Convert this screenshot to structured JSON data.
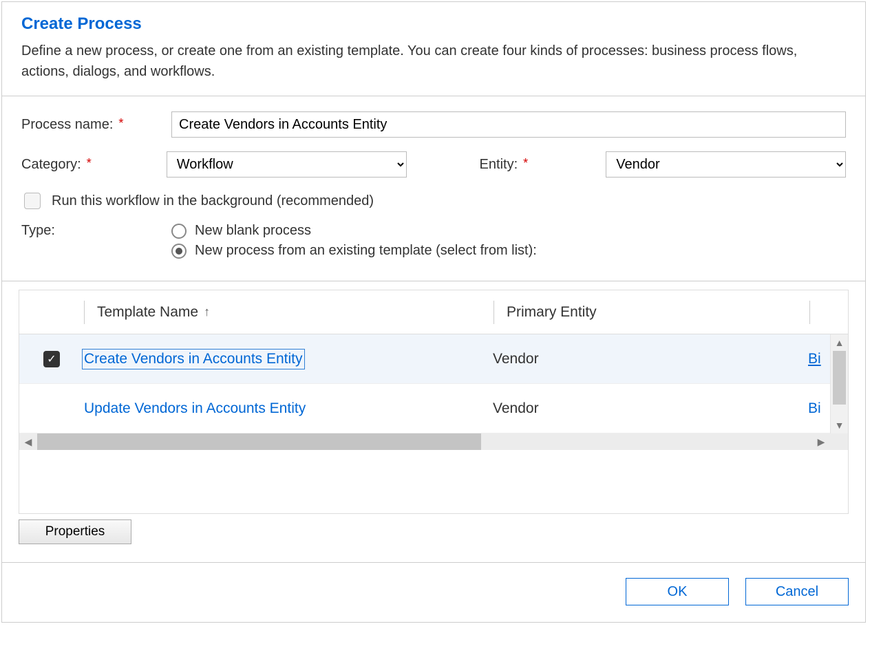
{
  "header": {
    "title": "Create Process",
    "description": "Define a new process, or create one from an existing template. You can create four kinds of processes: business process flows, actions, dialogs, and workflows."
  },
  "form": {
    "process_name_label": "Process name:",
    "process_name_value": "Create Vendors in Accounts Entity",
    "category_label": "Category:",
    "category_value": "Workflow",
    "entity_label": "Entity:",
    "entity_value": "Vendor",
    "background_label": "Run this workflow in the background (recommended)",
    "background_checked": false,
    "type_label": "Type:",
    "type_options": {
      "blank": {
        "label": "New blank process",
        "selected": false
      },
      "template": {
        "label": "New process from an existing template (select from list):",
        "selected": true
      }
    }
  },
  "grid": {
    "columns": {
      "template_name": "Template Name",
      "primary_entity": "Primary Entity"
    },
    "rows": [
      {
        "selected": true,
        "template_name": "Create Vendors in Accounts Entity",
        "primary_entity": "Vendor",
        "owner_fragment": "Bi"
      },
      {
        "selected": false,
        "template_name": "Update Vendors in Accounts Entity",
        "primary_entity": "Vendor",
        "owner_fragment": "Bi"
      }
    ]
  },
  "buttons": {
    "properties": "Properties",
    "ok": "OK",
    "cancel": "Cancel"
  },
  "icons": {
    "sort_asc": "↑",
    "check": "✓",
    "tri_left": "◀",
    "tri_right": "▶",
    "tri_up": "▲",
    "tri_down": "▼"
  }
}
